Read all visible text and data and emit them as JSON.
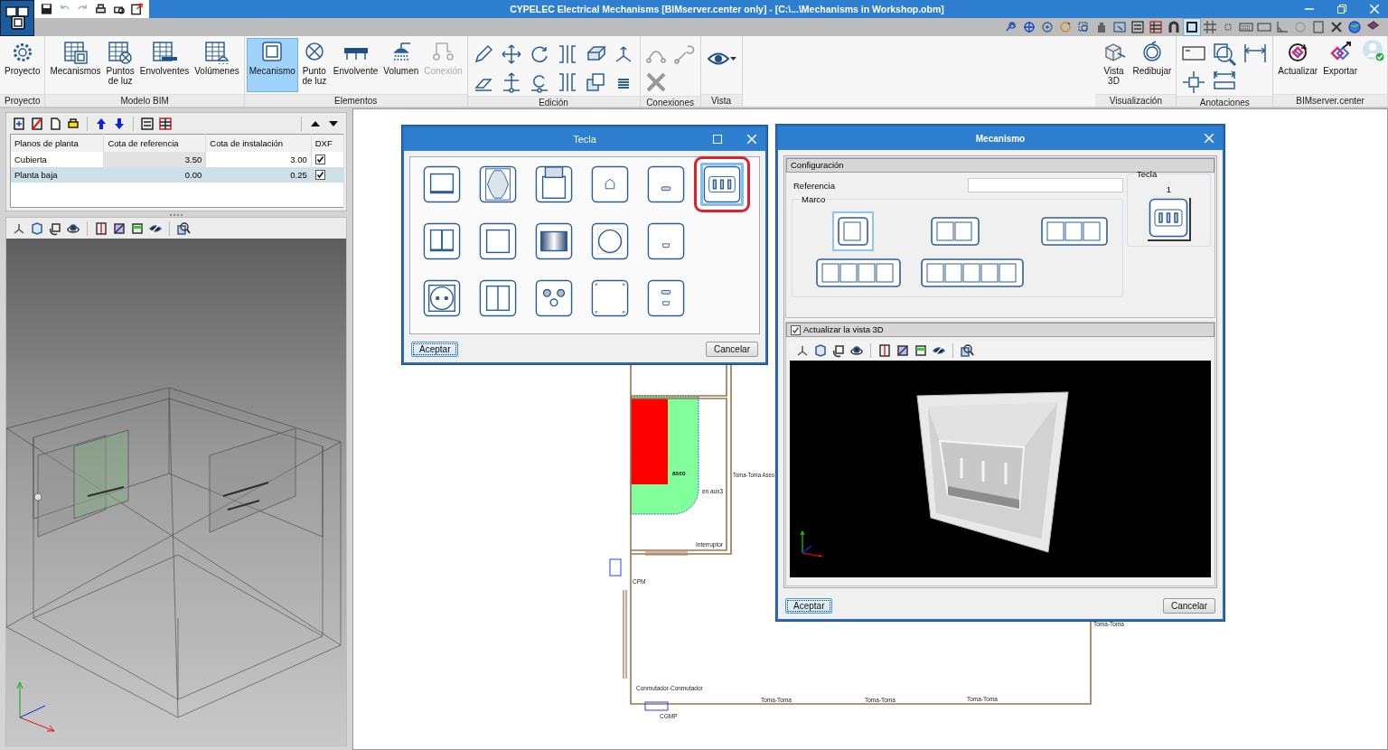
{
  "window": {
    "title": "CYPELEC Electrical Mechanisms [BIMserver.center only] - [C:\\...\\Mechanisms in Workshop.obm]"
  },
  "quick_access": [
    {
      "disabled": false
    },
    {
      "disabled": true
    },
    {
      "disabled": true
    },
    {
      "disabled": false
    },
    {
      "disabled": false
    },
    {
      "disabled": false
    }
  ],
  "view_toolbar": [
    {
      "selected": false
    },
    {
      "selected": false
    },
    {
      "selected": false
    },
    {
      "selected": false
    },
    {
      "selected": false
    },
    {
      "selected": false
    },
    {
      "selected": false
    },
    {
      "selected": false
    },
    {
      "selected": false
    },
    {
      "selected": false
    },
    {
      "selected": true
    },
    {
      "selected": false
    },
    {
      "selected": false
    },
    {
      "selected": false
    },
    {
      "selected": false
    },
    {
      "selected": false
    },
    {
      "selected": false
    },
    {
      "selected": false
    },
    {
      "selected": false
    },
    {
      "selected": false
    },
    {
      "selected": false
    }
  ],
  "ribbon": {
    "left_groups": [
      {
        "label": "Proyecto",
        "kind": "buttons",
        "buttons": [
          {
            "label": "Proyecto",
            "selected": false,
            "disabled": false
          }
        ]
      },
      {
        "label": "Modelo BIM",
        "kind": "buttons",
        "buttons": [
          {
            "label": "Mecanismos",
            "selected": false,
            "disabled": false
          },
          {
            "label": "Puntos\nde luz",
            "selected": false,
            "disabled": false
          },
          {
            "label": "Envolventes",
            "selected": false,
            "disabled": false
          },
          {
            "label": "Volúmenes",
            "selected": false,
            "disabled": false
          }
        ]
      },
      {
        "label": "Elementos",
        "kind": "buttons",
        "buttons": [
          {
            "label": "Mecanismo",
            "selected": true,
            "disabled": false
          },
          {
            "label": "Punto\nde luz",
            "selected": false,
            "disabled": false
          },
          {
            "label": "Envolvente",
            "selected": false,
            "disabled": false
          },
          {
            "label": "Volumen",
            "selected": false,
            "disabled": false
          },
          {
            "label": "Conexión",
            "selected": false,
            "disabled": true
          }
        ]
      },
      {
        "label": "Edición",
        "kind": "edit"
      },
      {
        "label": "Conexiones",
        "kind": "connections"
      },
      {
        "label": "Vista",
        "kind": "view"
      }
    ],
    "right_groups": [
      {
        "label": "Visualización",
        "kind": "buttons",
        "buttons": [
          {
            "label": "Vista\n3D",
            "selected": false,
            "disabled": false
          },
          {
            "label": "Redibujar",
            "selected": false,
            "disabled": false
          }
        ]
      },
      {
        "label": "Anotaciones",
        "kind": "annotations"
      },
      {
        "label": "BIMserver.center",
        "kind": "bimserver",
        "buttons": [
          {
            "label": "Actualizar",
            "selected": false,
            "disabled": false
          },
          {
            "label": "Exportar",
            "selected": false,
            "disabled": false
          }
        ]
      }
    ]
  },
  "floor_plans": {
    "columns": [
      "Planos de planta",
      "Cota de referencia",
      "Cota de instalación",
      "DXF"
    ],
    "rows": [
      {
        "name": "Cubierta",
        "reference": "3.50",
        "installation": "3.00",
        "dxf": true,
        "selected": false
      },
      {
        "name": "Planta baja",
        "reference": "0.00",
        "installation": "0.25",
        "dxf": true,
        "selected": true
      }
    ]
  },
  "plan_labels": [
    "Toma-Toma Aseo",
    "aseo",
    "en aux3",
    "Interruptor",
    "CPM",
    "Conmutador-Conmutador",
    "Toma-Toma",
    "Toma-Toma",
    "Toma-Toma",
    "Toma-Toma",
    "CGMP"
  ],
  "tecla_dialog": {
    "title": "Tecla",
    "keys": [
      {
        "selected": false
      },
      {
        "selected": false
      },
      {
        "selected": false
      },
      {
        "selected": false
      },
      {
        "selected": false
      },
      {
        "selected": true
      },
      {
        "selected": false
      },
      {
        "selected": false
      },
      {
        "selected": false
      },
      {
        "selected": false
      },
      {
        "selected": false
      },
      {
        "selected": false
      },
      {
        "selected": false
      },
      {
        "selected": false
      },
      {
        "selected": false
      },
      {
        "selected": false
      }
    ],
    "buttons": [
      "Aceptar",
      "Cancelar"
    ]
  },
  "mecanismo_dialog": {
    "title": "Mecanismo",
    "section": "Configuración",
    "reference_label": "Referencia",
    "frame": {
      "label": "Marco",
      "options": [
        {
          "selected": true
        },
        {
          "selected": false
        },
        {
          "selected": false
        },
        {
          "selected": false
        },
        {
          "selected": false
        }
      ]
    },
    "key": {
      "label": "Tecla",
      "count": "1"
    },
    "update_3d": {
      "label": "Actualizar la vista 3D",
      "checked": true
    },
    "buttons": [
      "Aceptar",
      "Cancelar"
    ]
  }
}
